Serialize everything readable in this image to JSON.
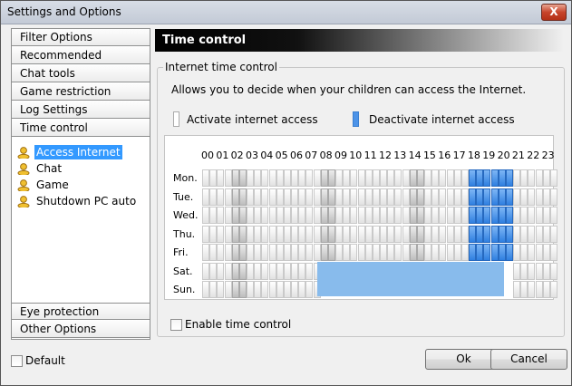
{
  "window": {
    "title": "Settings and Options",
    "close_glyph": "X"
  },
  "nav": {
    "top_items": [
      "Filter Options",
      "Recommended",
      "Chat tools",
      "Game restriction",
      "Log Settings",
      "Time control"
    ],
    "tree_items": [
      "Access Internet",
      "Chat",
      "Game",
      "Shutdown PC auto"
    ],
    "selected_tree_item": "Access Internet",
    "bottom_items": [
      "Eye protection",
      "Other Options"
    ]
  },
  "panel": {
    "header": "Time control",
    "group_title": "Internet time control",
    "description": "Allows you to decide when your children can access the Internet.",
    "legend_activate": "Activate internet access",
    "legend_deactivate": "Deactivate internet access",
    "enable_label": "Enable time control",
    "enable_checked": false
  },
  "schedule": {
    "hours": [
      "00",
      "01",
      "02",
      "03",
      "04",
      "05",
      "06",
      "07",
      "08",
      "09",
      "10",
      "11",
      "12",
      "13",
      "14",
      "15",
      "16",
      "17",
      "18",
      "19",
      "20",
      "21",
      "22",
      "23"
    ],
    "days": [
      "Mon.",
      "Tue.",
      "Wed.",
      "Thu.",
      "Fri.",
      "Sat.",
      "Sun."
    ],
    "weekday_blocked_slots": [
      36,
      37,
      38,
      39,
      40,
      41
    ],
    "weekend_blocked_slots": [
      16,
      17,
      18,
      19,
      20,
      21,
      22,
      23,
      24,
      25,
      26,
      27,
      28,
      29,
      30,
      31,
      32,
      33,
      34,
      35,
      36,
      37,
      38,
      39,
      40,
      41
    ]
  },
  "footer": {
    "default_label": "Default",
    "default_checked": false,
    "ok_label": "Ok",
    "cancel_label": "Cancel"
  },
  "colors": {
    "blocked": "#4c93e8",
    "weekend_blocked": "#88bbec",
    "header_bg": "#000000"
  }
}
